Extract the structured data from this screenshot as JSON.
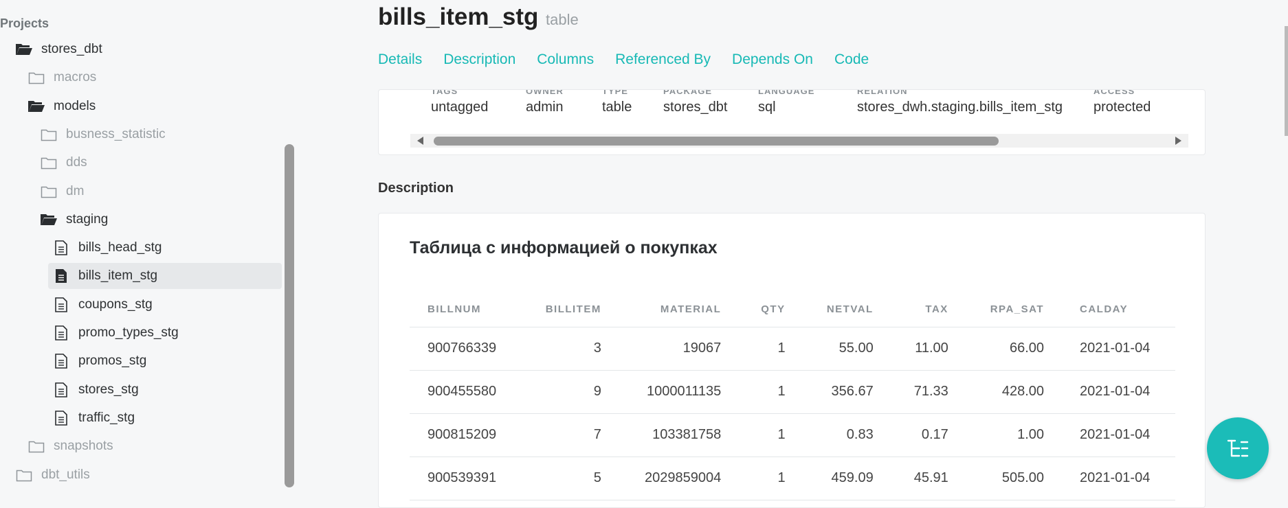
{
  "sidebar": {
    "title": "Projects",
    "tree": [
      {
        "label": "stores_dbt",
        "type": "folder-open",
        "depth": 1,
        "dark": true
      },
      {
        "label": "macros",
        "type": "folder",
        "depth": 2,
        "dark": false
      },
      {
        "label": "models",
        "type": "folder-open",
        "depth": 2,
        "dark": true
      },
      {
        "label": "busness_statistic",
        "type": "folder",
        "depth": 3,
        "dark": false
      },
      {
        "label": "dds",
        "type": "folder",
        "depth": 3,
        "dark": false
      },
      {
        "label": "dm",
        "type": "folder",
        "depth": 3,
        "dark": false
      },
      {
        "label": "staging",
        "type": "folder-open",
        "depth": 3,
        "dark": true
      },
      {
        "label": "bills_head_stg",
        "type": "file",
        "depth": 4,
        "dark": true
      },
      {
        "label": "bills_item_stg",
        "type": "file-filled",
        "depth": 4,
        "dark": true,
        "selected": true
      },
      {
        "label": "coupons_stg",
        "type": "file",
        "depth": 4,
        "dark": true
      },
      {
        "label": "promo_types_stg",
        "type": "file",
        "depth": 4,
        "dark": true
      },
      {
        "label": "promos_stg",
        "type": "file",
        "depth": 4,
        "dark": true
      },
      {
        "label": "stores_stg",
        "type": "file",
        "depth": 4,
        "dark": true
      },
      {
        "label": "traffic_stg",
        "type": "file",
        "depth": 4,
        "dark": true
      },
      {
        "label": "snapshots",
        "type": "folder",
        "depth": 2,
        "dark": false
      },
      {
        "label": "dbt_utils",
        "type": "folder",
        "depth": 1,
        "dark": false
      }
    ]
  },
  "header": {
    "title": "bills_item_stg",
    "kind": "table"
  },
  "tabs": [
    "Details",
    "Description",
    "Columns",
    "Referenced By",
    "Depends On",
    "Code"
  ],
  "details": {
    "headers": [
      "TAGS",
      "OWNER",
      "TYPE",
      "PACKAGE",
      "LANGUAGE",
      "RELATION",
      "ACCESS"
    ],
    "values": [
      "untagged",
      "admin",
      "table",
      "stores_dbt",
      "sql",
      "stores_dwh.staging.bills_item_stg",
      "protected"
    ]
  },
  "description": {
    "section_title": "Description",
    "heading": "Таблица с информацией о покупках",
    "table": {
      "columns": [
        "BILLNUM",
        "BILLITEM",
        "MATERIAL",
        "QTY",
        "NETVAL",
        "TAX",
        "RPA_SAT",
        "CALDAY"
      ],
      "rows": [
        [
          "900766339",
          "3",
          "19067",
          "1",
          "55.00",
          "11.00",
          "66.00",
          "2021-01-04"
        ],
        [
          "900455580",
          "9",
          "1000011135",
          "1",
          "356.67",
          "71.33",
          "428.00",
          "2021-01-04"
        ],
        [
          "900815209",
          "7",
          "103381758",
          "1",
          "0.83",
          "0.17",
          "1.00",
          "2021-01-04"
        ],
        [
          "900539391",
          "5",
          "2029859004",
          "1",
          "459.09",
          "45.91",
          "505.00",
          "2021-01-04"
        ]
      ]
    }
  },
  "colors": {
    "accent": "#17b9b5",
    "fab": "#1bbcb8"
  },
  "fab_icon": "tree-icon"
}
